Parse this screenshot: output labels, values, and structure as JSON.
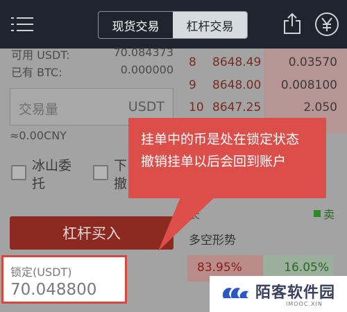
{
  "header": {
    "tabs": [
      {
        "label": "现货交易",
        "active": false
      },
      {
        "label": "杠杆交易",
        "active": true
      }
    ]
  },
  "balances": {
    "available_label": "可用 USDT:",
    "available_value": "70.084373",
    "held_label": "已有 BTC:",
    "held_value": "0.000000"
  },
  "order_form": {
    "quantity_placeholder": "交易量",
    "quantity_unit": "USDT",
    "approx_value": "≈0.00CNY",
    "iceberg_label_1": "冰山委",
    "iceberg_label_2": "托",
    "other_label_1": "下",
    "other_label_2": "撤",
    "buy_button": "杠杆买入"
  },
  "locked": {
    "label": "锁定(USDT)",
    "value": "70.048800"
  },
  "order_book": {
    "rows": [
      {
        "index": "8",
        "price": "8648.49",
        "amount": "0.03570"
      },
      {
        "index": "9",
        "price": "8648.00",
        "amount": "0.008100"
      },
      {
        "index": "10",
        "price": "8647.25",
        "amount": "2.050"
      }
    ],
    "partial_label": "长",
    "sell_legend": "卖"
  },
  "trend": {
    "title": "多空形势",
    "long_pct": "83.95%",
    "short_pct": "16.05%",
    "long_fraction": 0.8395
  },
  "callout": {
    "line1": "挂单中的币是处在锁定状态",
    "line2": "撤销挂单以后会回到账户"
  },
  "watermark": {
    "title": "陌客软件园",
    "subtitle": "IMOOC.XIN"
  },
  "colors": {
    "header_bg": "#20242e",
    "accent_red": "#dc4e49",
    "buy_red": "#8c2a22",
    "sell_green": "#2a8a2a"
  }
}
